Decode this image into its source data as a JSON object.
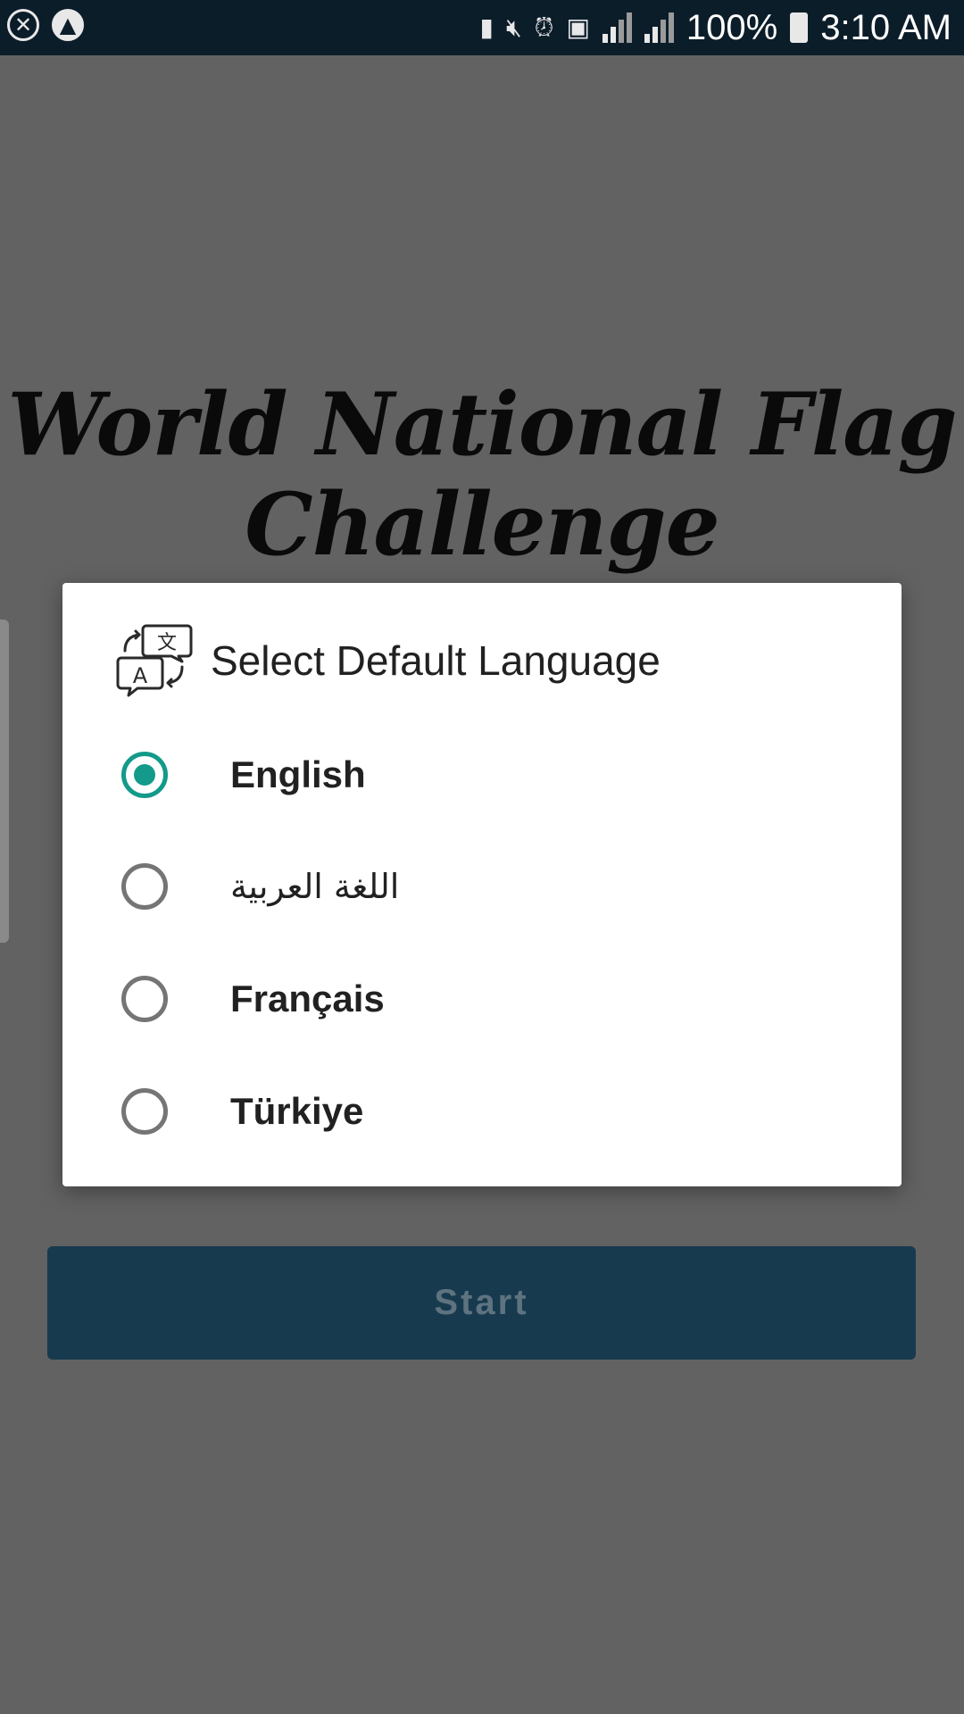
{
  "status_bar": {
    "battery_percent": "100%",
    "time": "3:10 AM",
    "icons": [
      "close-circle-icon",
      "app-notification-icon",
      "battery-saver-icon",
      "mute-icon",
      "alarm-icon",
      "sim-icon",
      "roaming-signal-icon",
      "signal-icon",
      "battery-charging-icon"
    ]
  },
  "app": {
    "title": "World National Flag Challenge",
    "start_label": "Start"
  },
  "dialog": {
    "title": "Select Default Language",
    "icon": "translate-icon",
    "selected_index": 0,
    "options": [
      {
        "label": "English",
        "checked": true
      },
      {
        "label": "اللغة العربية",
        "checked": false
      },
      {
        "label": "Français",
        "checked": false
      },
      {
        "label": "Türkiye",
        "checked": false
      }
    ]
  },
  "colors": {
    "accent": "#139a8a",
    "status_bar": "#0c1d2a",
    "start_button": "#183a4e",
    "scrim_background": "#626262"
  }
}
